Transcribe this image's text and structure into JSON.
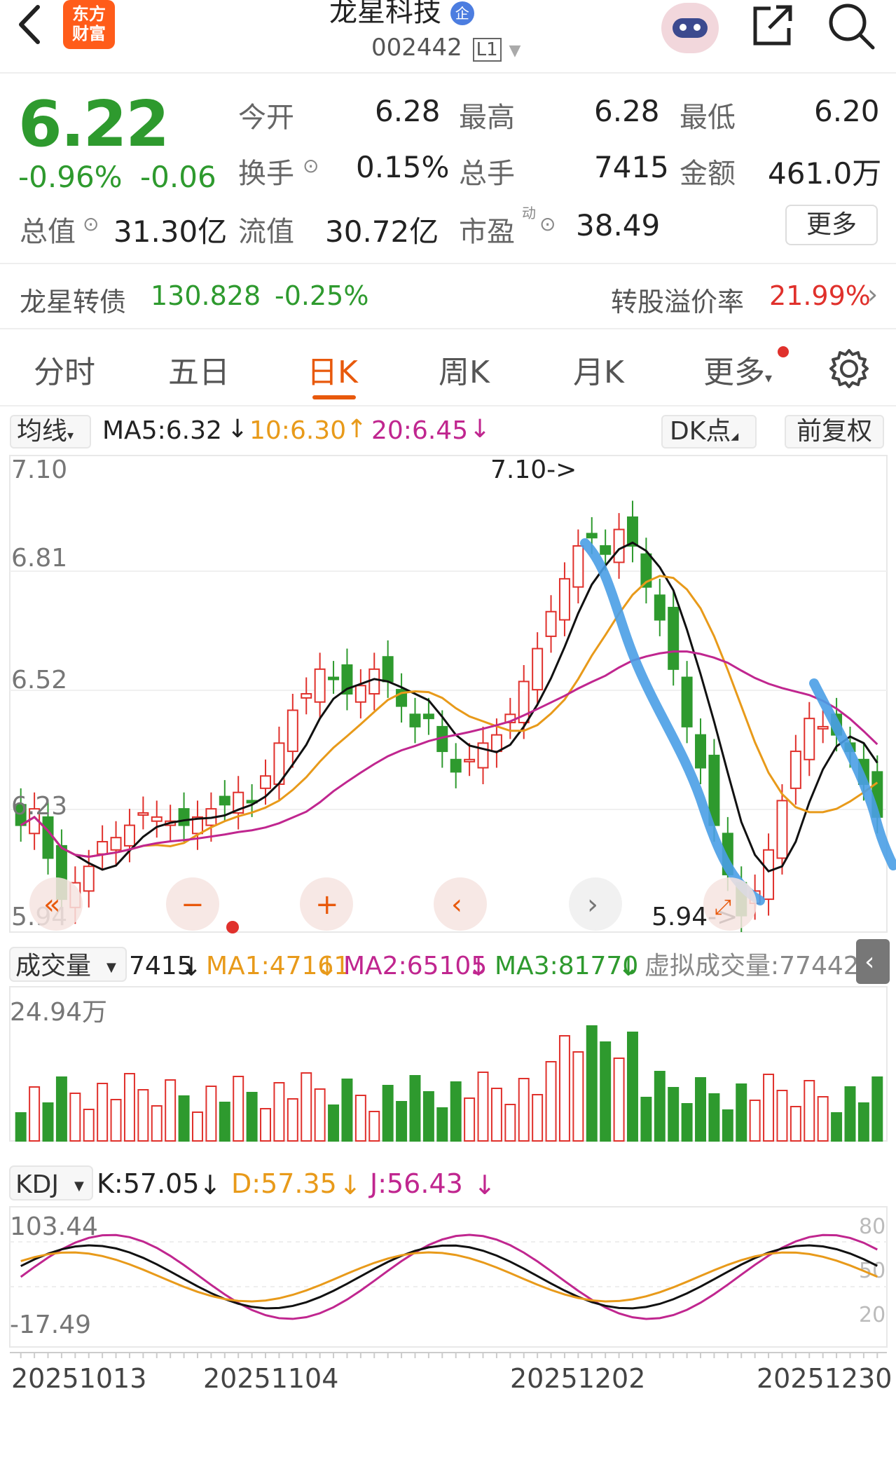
{
  "header": {
    "back_icon": "chevron-left-icon",
    "logo_text": "东方财富",
    "stock_name": "龙星科技",
    "badge": "企",
    "stock_code": "002442",
    "level": "L1",
    "share_icon": "share-icon",
    "search_icon": "search-icon"
  },
  "quote": {
    "price": "6.22",
    "change_pct": "-0.96%",
    "change": "-0.06",
    "rows": [
      {
        "label": "今开",
        "value": "6.28"
      },
      {
        "label": "最高",
        "value": "6.28"
      },
      {
        "label": "最低",
        "value": "6.20"
      },
      {
        "label": "换手",
        "value": "0.15%"
      },
      {
        "label": "总手",
        "value": "7415"
      },
      {
        "label": "金额",
        "value": "461.0万"
      },
      {
        "label": "总值",
        "value": "31.30亿"
      },
      {
        "label": "流值",
        "value": "30.72亿"
      },
      {
        "label": "市盈",
        "value": "38.49"
      }
    ],
    "pe_sup": "动",
    "more": "更多"
  },
  "bond": {
    "name": "龙星转债",
    "price": "130.828",
    "change": "-0.25%",
    "premium_label": "转股溢价率",
    "premium_value": "21.99%"
  },
  "tabs": [
    "分时",
    "五日",
    "日K",
    "周K",
    "月K",
    "更多"
  ],
  "active_tab": "日K",
  "ma_bar": {
    "selector": "均线",
    "ma5": "MA5:6.32",
    "ma10": "10:6.30",
    "ma20": "20:6.45",
    "dk": "DK点",
    "adjust": "前复权"
  },
  "kline": {
    "y_labels": [
      "7.10",
      "6.81",
      "6.52",
      "6.23",
      "5.94"
    ],
    "high_marker": "7.10->",
    "low_marker": "5.94->"
  },
  "volume_bar": {
    "selector": "成交量",
    "vol": "7415",
    "ma1": "MA1:47161",
    "ma2": "MA2:65105",
    "ma3": "MA3:81770",
    "virtual": "虚拟成交量:77442",
    "max_label": "24.94万"
  },
  "kdj_bar": {
    "selector": "KDJ",
    "k": "K:57.05",
    "d": "D:57.35",
    "j": "J:56.43",
    "max_label": "103.44",
    "min_label": "-17.49",
    "right_labels": [
      "80",
      "50",
      "20"
    ]
  },
  "x_labels": [
    "20251013",
    "20251104",
    "20251202",
    "20251230"
  ],
  "colors": {
    "up": "#e0312c",
    "down": "#2e9a2e",
    "ma5": "#111111",
    "ma10": "#e89a1a",
    "ma20": "#c0268f",
    "annotation": "#4a9ee6"
  }
}
